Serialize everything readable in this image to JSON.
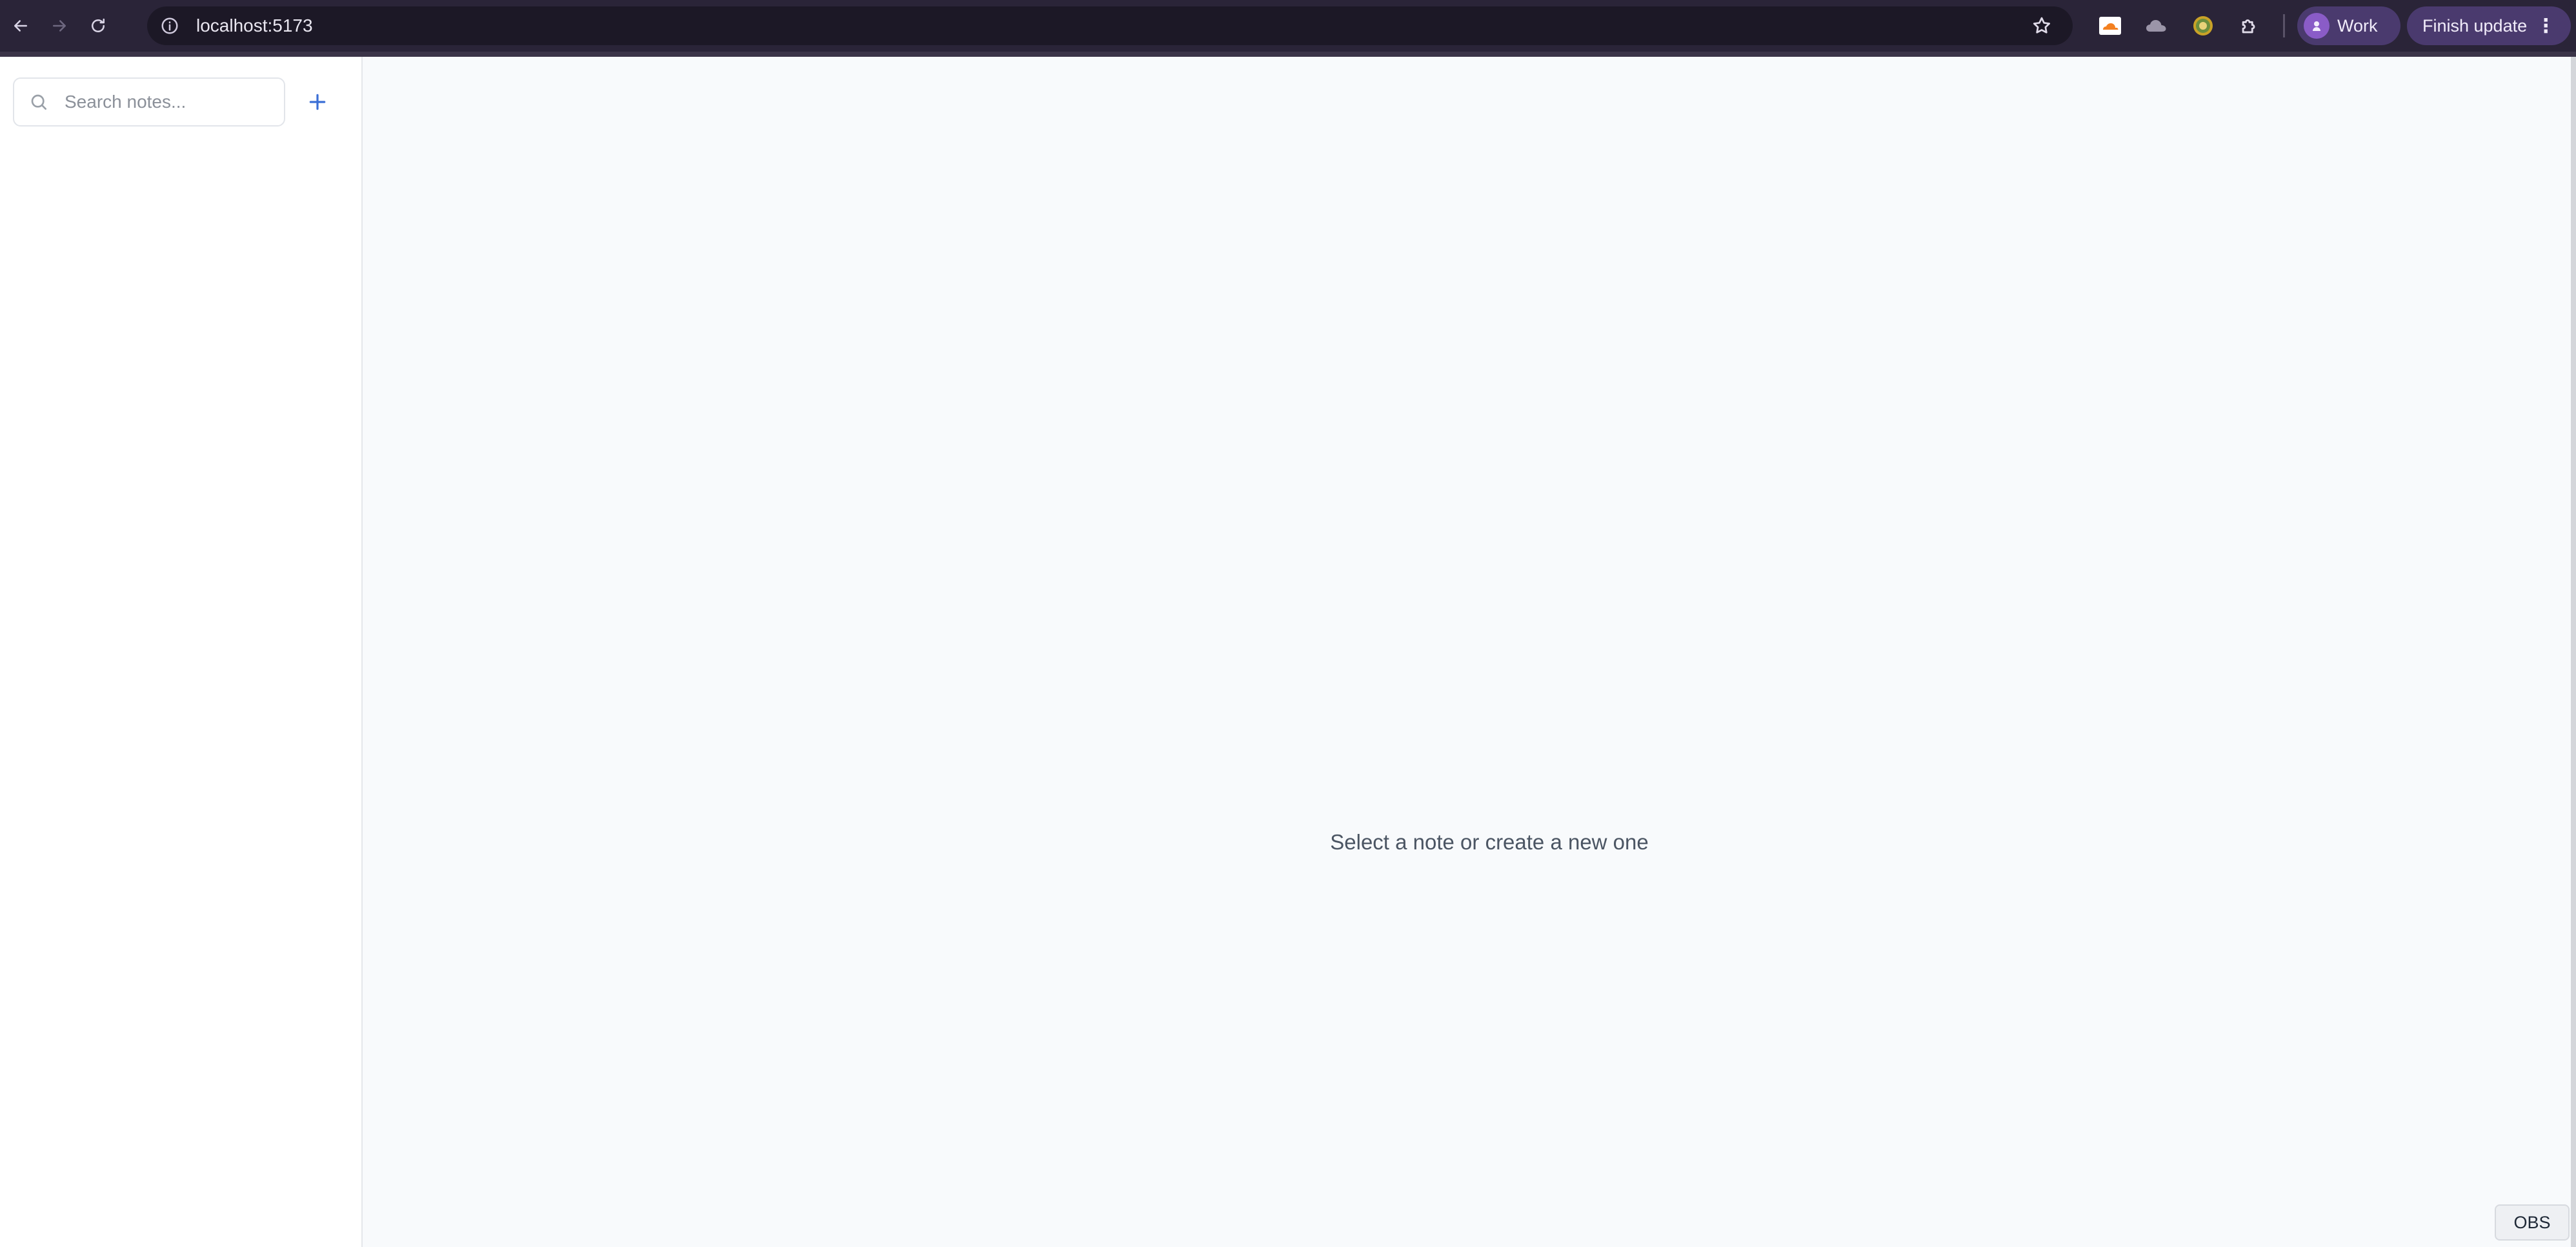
{
  "browser": {
    "url": "localhost:5173",
    "profile_label": "Work",
    "update_label": "Finish update",
    "icons": {
      "back": "arrow-left-icon",
      "forward": "arrow-right-icon",
      "reload": "reload-icon",
      "site_info": "info-circle-icon",
      "bookmark": "star-icon",
      "extensions": [
        "cloudflare-icon",
        "cloud-icon",
        "coin-icon",
        "puzzle-piece-icon"
      ],
      "menu": "kebab-menu-icon"
    }
  },
  "sidebar": {
    "search": {
      "placeholder": "Search notes...",
      "value": ""
    },
    "add_icon": "plus-icon",
    "notes": []
  },
  "main": {
    "empty_message": "Select a note or create a new one"
  },
  "overlay": {
    "badge_label": "OBS"
  },
  "colors": {
    "chrome_bg": "#2a2438",
    "omnibox_bg": "#1c1826",
    "pill_bg": "#4a3a6e",
    "accent_blue": "#3b6fd6",
    "main_bg": "#f8fafc"
  }
}
